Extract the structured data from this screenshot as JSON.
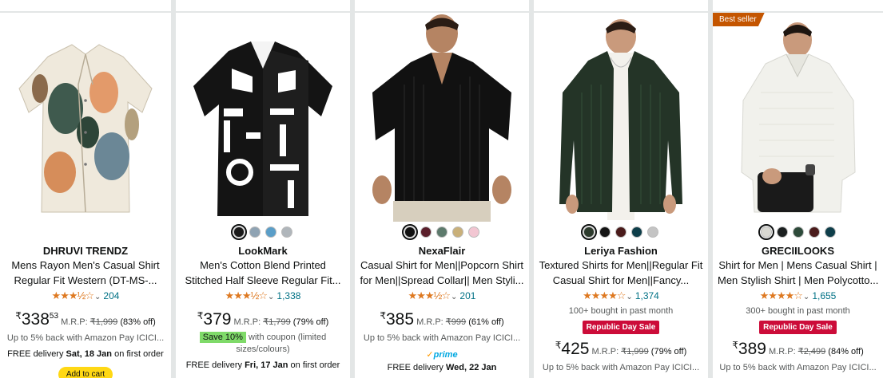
{
  "products": [
    {
      "brand": "DHRUVI TRENDZ",
      "title_line1": "Mens Rayon Men's Casual Shirt",
      "title_line2": "Regular Fit Western (DT-MS-...",
      "rating": 3.5,
      "stars": "★★★½☆",
      "rating_count": "204",
      "currency": "₹",
      "price_whole": "338",
      "price_fraction": "53",
      "mrp_label": "M.R.P:",
      "mrp": "₹1,999",
      "discount": "(83% off)",
      "note": "Up to 5% back with Amazon Pay ICICI...",
      "delivery_prefix": "FREE delivery",
      "delivery_date": "Sat, 18 Jan",
      "delivery_suffix": "on first order",
      "add_to_cart": "Add to cart"
    },
    {
      "brand": "LookMark",
      "title_line1": "Men's Cotton Blend Printed",
      "title_line2": "Stitched Half Sleeve Regular Fit...",
      "swatches": [
        "#1a1a1a",
        "#8fa3b3",
        "#5a9ec8",
        "#b0b6bb"
      ],
      "rating": 3.5,
      "stars": "★★★½☆",
      "rating_count": "1,338",
      "currency": "₹",
      "price_whole": "379",
      "mrp_label": "M.R.P:",
      "mrp": "₹1,799",
      "discount": "(79% off)",
      "coupon_tag": "Save 10%",
      "coupon_text": "with coupon (limited sizes/colours)",
      "delivery_prefix": "FREE delivery",
      "delivery_date": "Fri, 17 Jan",
      "delivery_suffix": "on first order"
    },
    {
      "brand": "NexaFlair",
      "title_line1": "Casual Shirt for Men||Popcorn Shirt",
      "title_line2": "for Men||Spread Collar|| Men Styli...",
      "swatches": [
        "#111111",
        "#5a1e2a",
        "#5d7a6c",
        "#c9b07a",
        "#f2c6d2"
      ],
      "rating": 3.5,
      "stars": "★★★½☆",
      "rating_count": "201",
      "currency": "₹",
      "price_whole": "385",
      "mrp_label": "M.R.P:",
      "mrp": "₹999",
      "discount": "(61% off)",
      "note": "Up to 5% back with Amazon Pay ICICI...",
      "prime": "prime",
      "delivery_prefix": "FREE delivery",
      "delivery_date": "Wed, 22 Jan"
    },
    {
      "brand": "Leriya Fashion",
      "title_line1": "Textured Shirts for Men||Regular Fit",
      "title_line2": "Casual Shirt for Men||Fancy...",
      "swatches": [
        "#2c3a2c",
        "#141414",
        "#4a1b1b",
        "#0e3e4a",
        "#c4c4c4"
      ],
      "rating": 4,
      "stars": "★★★★☆",
      "rating_count": "1,374",
      "bought": "100+ bought in past month",
      "deal": "Republic Day Sale",
      "currency": "₹",
      "price_whole": "425",
      "mrp_label": "M.R.P:",
      "mrp": "₹1,999",
      "discount": "(79% off)",
      "note": "Up to 5% back with Amazon Pay ICICI..."
    },
    {
      "badge": "Best seller",
      "brand": "GRECIILOOKS",
      "title_line1": "Shirt for Men | Mens Casual Shirt |",
      "title_line2": "Men Stylish Shirt | Men Polycotto...",
      "swatches": [
        "#d8d8d2",
        "#1b1f1f",
        "#2d4a3a",
        "#4a1b1b",
        "#0e3e4a"
      ],
      "rating": 4,
      "stars": "★★★★☆",
      "rating_count": "1,655",
      "bought": "300+ bought in past month",
      "deal": "Republic Day Sale",
      "currency": "₹",
      "price_whole": "389",
      "mrp_label": "M.R.P:",
      "mrp": "₹2,499",
      "discount": "(84% off)",
      "note": "Up to 5% back with Amazon Pay ICICI..."
    }
  ],
  "icons": {
    "rating_dropdown": "chevron-down-icon",
    "prime": "prime-check-icon"
  }
}
